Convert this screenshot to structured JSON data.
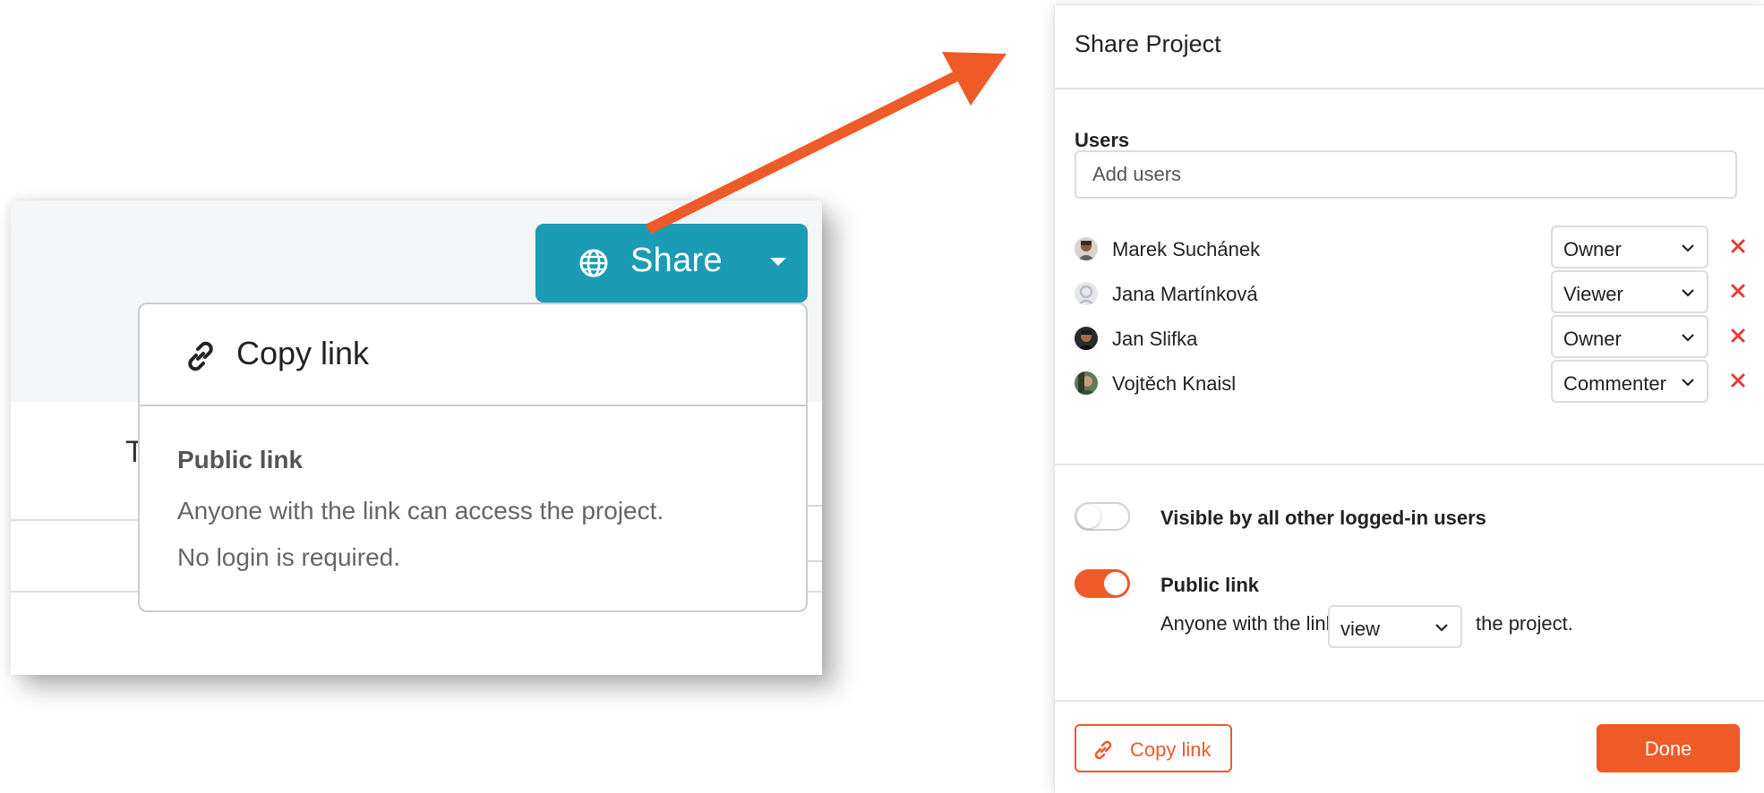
{
  "share_button": {
    "label": "Share",
    "icon": "globe-icon"
  },
  "share_dropdown": {
    "copy_link_label": "Copy link",
    "public_link_title": "Public link",
    "public_link_desc_line1": "Anyone with the link can access the project.",
    "public_link_desc_line2": "No login is required.",
    "partial_header_text": "T"
  },
  "modal": {
    "title": "Share Project",
    "users_label": "Users",
    "add_users_placeholder": "Add users",
    "users": [
      {
        "name": "Marek Suchánek",
        "role": "Owner"
      },
      {
        "name": "Jana Martínková",
        "role": "Viewer"
      },
      {
        "name": "Jan Slifka",
        "role": "Owner"
      },
      {
        "name": "Vojtěch Knaisl",
        "role": "Commenter"
      }
    ],
    "visible_toggle": {
      "label": "Visible by all other logged-in users",
      "on": false
    },
    "public_link_toggle": {
      "label": "Public link",
      "on": true
    },
    "public_link_sentence_prefix": "Anyone with the link can",
    "public_link_permission": "view",
    "public_link_sentence_suffix": "the project.",
    "copy_link_button": "Copy link",
    "done_button": "Done"
  },
  "colors": {
    "accent": "#ee5a28",
    "share_button": "#1b9cb4",
    "remove_icon": "#e23c3c"
  }
}
